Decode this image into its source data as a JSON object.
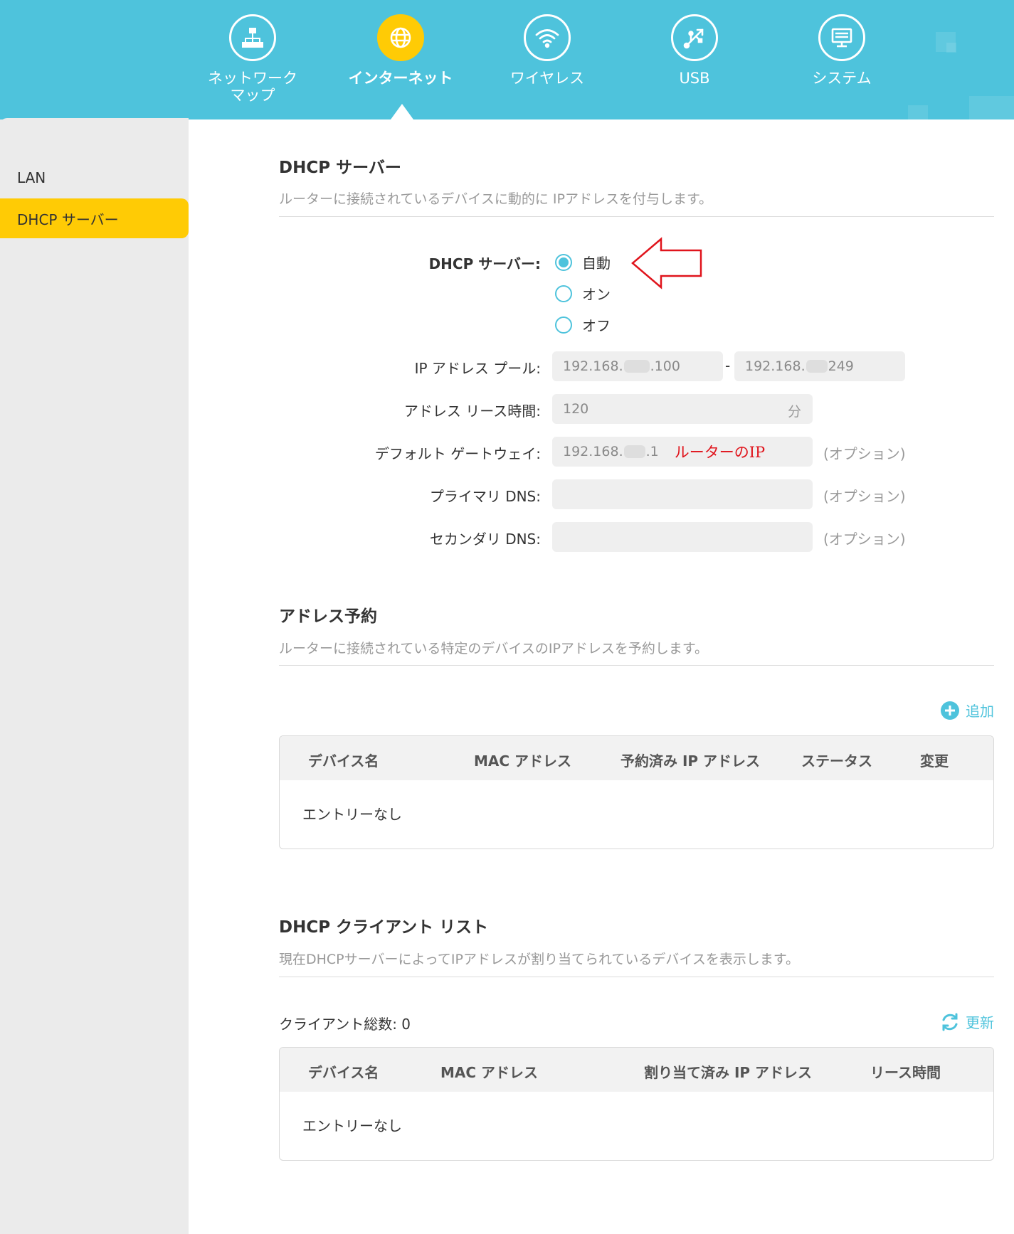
{
  "nav": {
    "items": [
      {
        "label": "ネットワーク\nマップ",
        "icon": "network-map-icon",
        "active": false
      },
      {
        "label": "インターネット",
        "icon": "globe-icon",
        "active": true
      },
      {
        "label": "ワイヤレス",
        "icon": "wifi-icon",
        "active": false
      },
      {
        "label": "USB",
        "icon": "usb-icon",
        "active": false
      },
      {
        "label": "システム",
        "icon": "system-icon",
        "active": false
      }
    ]
  },
  "sidebar": {
    "items": [
      {
        "label": "LAN",
        "active": false
      },
      {
        "label": "DHCP サーバー",
        "active": true
      }
    ]
  },
  "dhcp": {
    "title": "DHCP サーバー",
    "description": "ルーターに接続されているデバイスに動的に IPアドレスを付与します。",
    "mode_label": "DHCP サーバー:",
    "modes": [
      "自動",
      "オン",
      "オフ"
    ],
    "selected_mode": "自動",
    "pool_label": "IP アドレス プール:",
    "pool_start_prefix": "192.168.",
    "pool_start_suffix": ".100",
    "pool_dash": "-",
    "pool_end_prefix": "192.168.",
    "pool_end_suffix": " 249",
    "lease_label": "アドレス リース時間:",
    "lease_value": "120",
    "lease_unit": "分",
    "gateway_label": "デフォルト ゲートウェイ:",
    "gateway_prefix": "192.168.",
    "gateway_suffix": ".1",
    "gateway_annotation": "ルーターのIP",
    "primary_dns_label": "プライマリ DNS:",
    "primary_dns_value": "",
    "secondary_dns_label": "セカンダリ DNS:",
    "secondary_dns_value": "",
    "optional_text": "(オプション)"
  },
  "reservation": {
    "title": "アドレス予約",
    "description": "ルーターに接続されている特定のデバイスのIPアドレスを予約します。",
    "add_label": "追加",
    "columns": [
      "デバイス名",
      "MAC アドレス",
      "予約済み IP アドレス",
      "ステータス",
      "変更"
    ],
    "empty_text": "エントリーなし"
  },
  "clients": {
    "title": "DHCP クライアント リスト",
    "description": "現在DHCPサーバーによってIPアドレスが割り当てられているデバイスを表示します。",
    "count_label": "クライアント総数: 0",
    "refresh_label": "更新",
    "columns": [
      "デバイス名",
      "MAC アドレス",
      "割り当て済み IP アドレス",
      "リース時間"
    ],
    "empty_text": "エントリーなし"
  },
  "colors": {
    "header": "#4ec3dc",
    "accent": "#ffcb05",
    "annotation": "#e0141c"
  }
}
